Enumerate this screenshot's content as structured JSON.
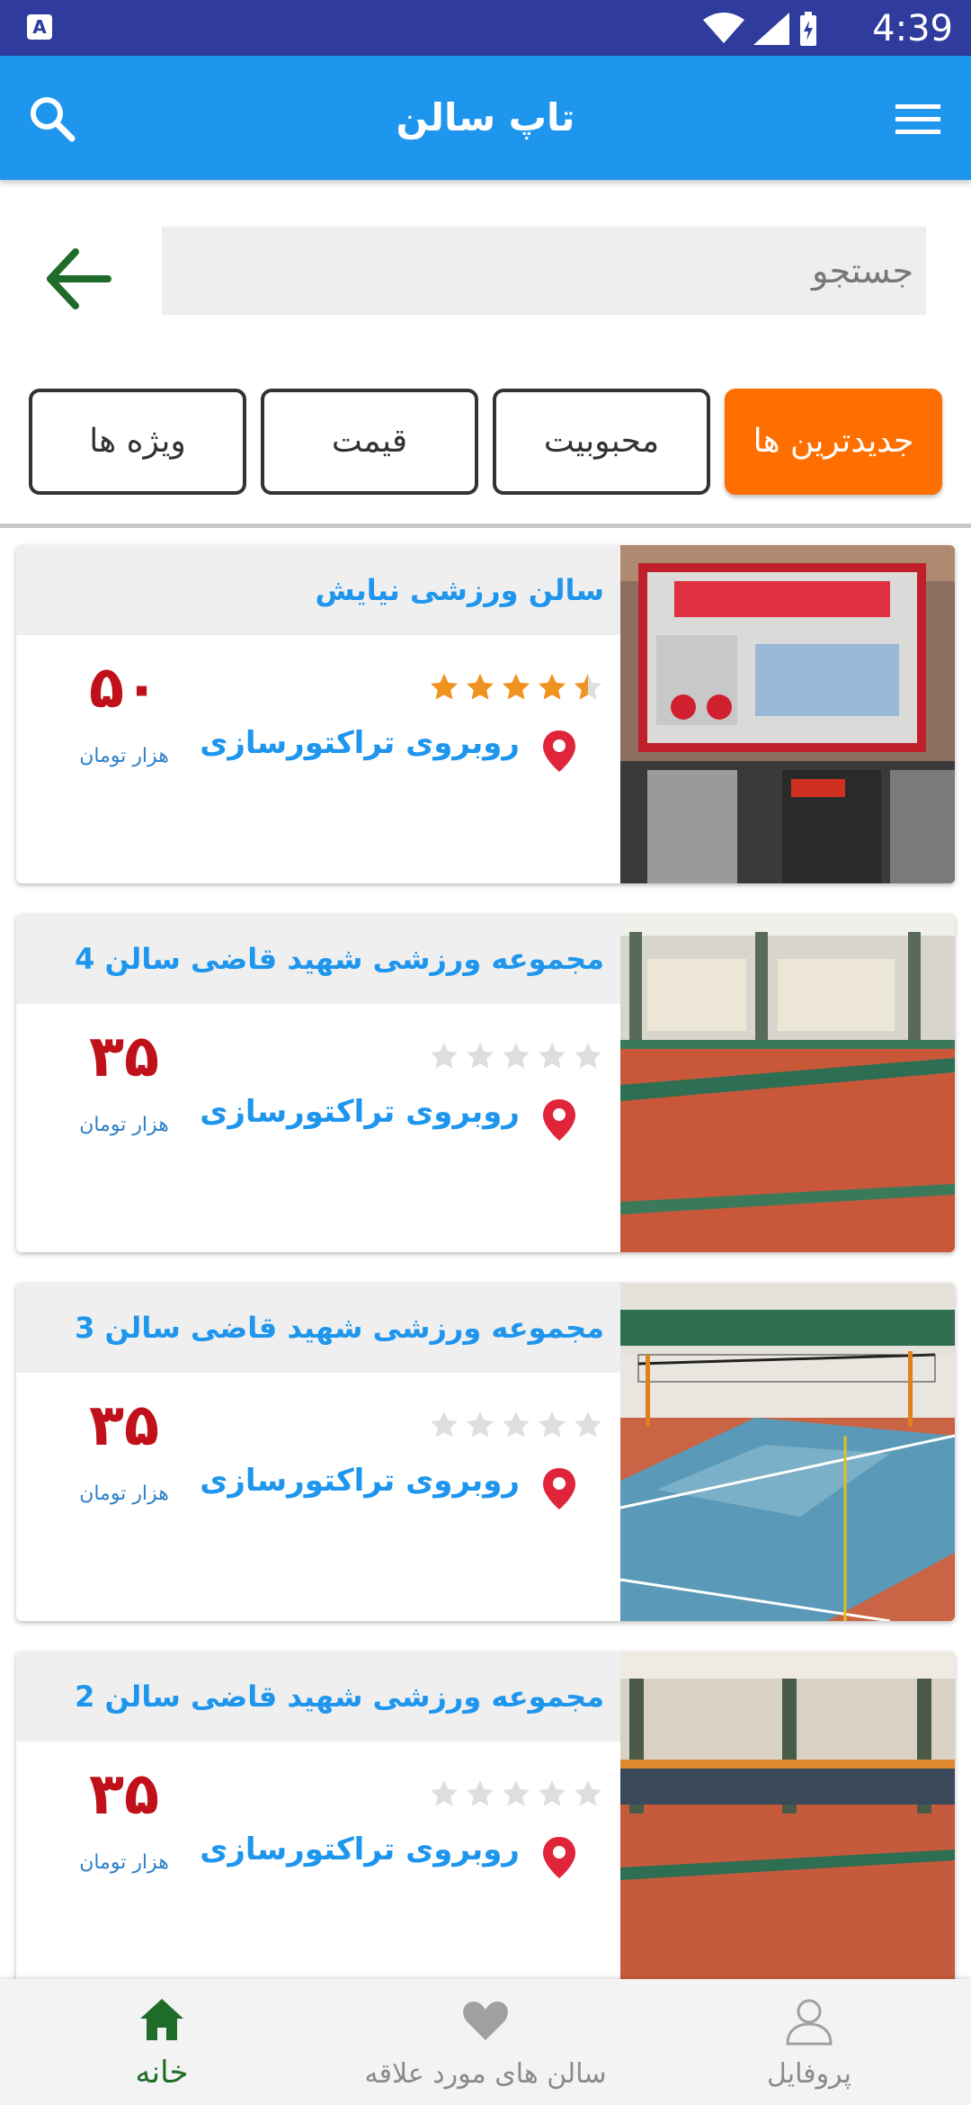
{
  "status_bar": {
    "time": "4:39",
    "notif_letter": "A"
  },
  "app_bar": {
    "title": "تاپ سالن",
    "search_icon": "search-icon",
    "menu_icon": "menu-icon"
  },
  "search": {
    "placeholder": "جستجو",
    "value": "",
    "back_icon": "arrow-back-icon"
  },
  "filters": [
    {
      "label": "جدیدترین ها",
      "active": true
    },
    {
      "label": "محبوبیت",
      "active": false
    },
    {
      "label": "قیمت",
      "active": false
    },
    {
      "label": "ویژه ها",
      "active": false
    }
  ],
  "colors": {
    "primary": "#1f96ee",
    "status": "#2f3c9e",
    "accent": "#ff6f00",
    "price": "#c0101a",
    "star": "#f0921f",
    "pin": "#e0253a",
    "home": "#1f6b2a"
  },
  "halls": [
    {
      "name": "سالن ورزشی نیایش",
      "location": "روبروی تراکتورسازی",
      "rating": 4.5,
      "price": "۵۰",
      "price_unit": "هزار تومان",
      "photo": "storefront"
    },
    {
      "name": "مجموعه ورزشی شهید قاضی سالن 4",
      "location": "روبروی تراکتورسازی",
      "rating": 0,
      "price": "۳۵",
      "price_unit": "هزار تومان",
      "photo": "hall-red-floor"
    },
    {
      "name": "مجموعه ورزشی شهید قاضی سالن 3",
      "location": "روبروی تراکتورسازی",
      "rating": 0,
      "price": "۳۵",
      "price_unit": "هزار تومان",
      "photo": "hall-volleyball"
    },
    {
      "name": "مجموعه ورزشی شهید قاضی سالن 2",
      "location": "روبروی تراکتورسازی",
      "rating": 0,
      "price": "۳۵",
      "price_unit": "هزار تومان",
      "photo": "hall-orange-floor"
    }
  ],
  "bottom_nav": [
    {
      "label": "خانه",
      "icon": "home-icon",
      "active": true
    },
    {
      "label": "سالن های مورد علاقه",
      "icon": "heart-icon",
      "active": false
    },
    {
      "label": "پروفایل",
      "icon": "profile-icon",
      "active": false
    }
  ]
}
